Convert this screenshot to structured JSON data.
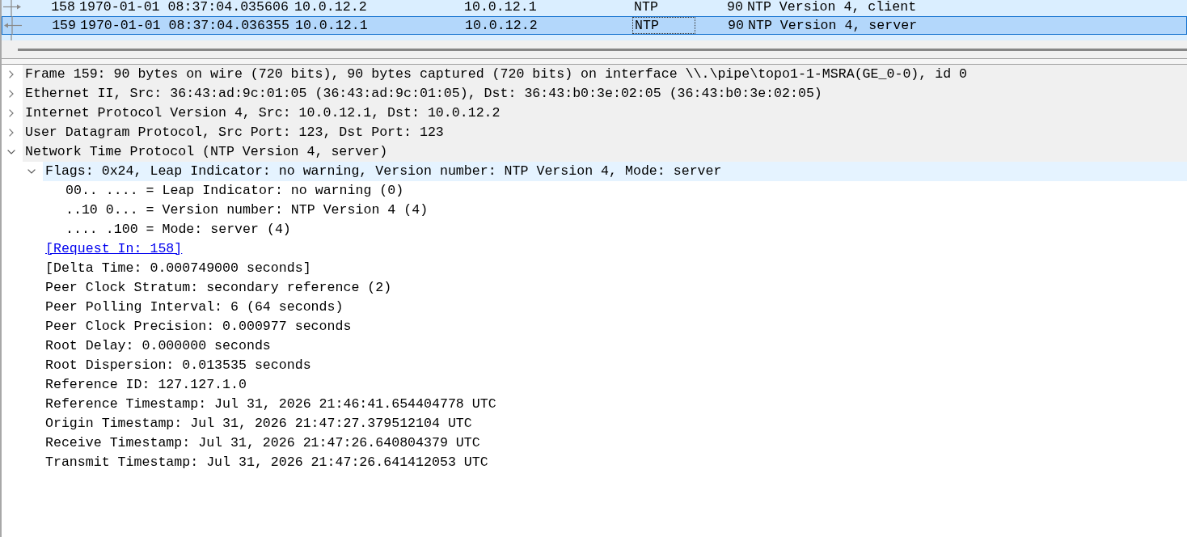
{
  "packet_list": {
    "rows": [
      {
        "no": "158",
        "time": "1970-01-01 08:37:04.035606",
        "source": "10.0.12.2",
        "destination": "10.0.12.1",
        "protocol": "NTP",
        "length": "90",
        "info": "NTP Version 4, client",
        "kind": "request",
        "selected": false,
        "focused": false
      },
      {
        "no": "159",
        "time": "1970-01-01 08:37:04.036355",
        "source": "10.0.12.1",
        "destination": "10.0.12.2",
        "protocol": "NTP",
        "length": "90",
        "info": "NTP Version 4, server",
        "kind": "response",
        "selected": true,
        "focused": true
      },
      {
        "kind": "line",
        "selected": false
      }
    ]
  },
  "details": {
    "tree": [
      {
        "label": "Frame 159: 90 bytes on wire (720 bits), 90 bytes captured (720 bits) on interface \\\\.\\pipe\\topo1-1-MSRA(GE_0-0), id 0",
        "expanded": false
      },
      {
        "label": "Ethernet II, Src: 36:43:ad:9c:01:05 (36:43:ad:9c:01:05), Dst: 36:43:b0:3e:02:05 (36:43:b0:3e:02:05)",
        "expanded": false
      },
      {
        "label": "Internet Protocol Version 4, Src: 10.0.12.1, Dst: 10.0.12.2",
        "expanded": false
      },
      {
        "label": "User Datagram Protocol, Src Port: 123, Dst Port: 123",
        "expanded": false
      },
      {
        "label": "Network Time Protocol (NTP Version 4, server)",
        "expanded": true,
        "children": [
          {
            "kind": "field",
            "label": "Flags: 0x24, Leap Indicator: no warning, Version number: NTP Version 4, Mode: server",
            "expanded": true,
            "hovered": true,
            "children": [
              {
                "label": "00.. .... = Leap Indicator: no warning (0)"
              },
              {
                "label": "..10 0... = Version number: NTP Version 4 (4)"
              },
              {
                "label": ".... .100 = Mode: server (4)"
              }
            ]
          },
          {
            "kind": "link",
            "label": "[Request In: 158]"
          },
          {
            "kind": "field",
            "label": "[Delta Time: 0.000749000 seconds]"
          },
          {
            "kind": "field",
            "label": "Peer Clock Stratum: secondary reference (2)"
          },
          {
            "kind": "field",
            "label": "Peer Polling Interval: 6 (64 seconds)"
          },
          {
            "kind": "field",
            "label": "Peer Clock Precision: 0.000977 seconds"
          },
          {
            "kind": "field",
            "label": "Root Delay: 0.000000 seconds"
          },
          {
            "kind": "field",
            "label": "Root Dispersion: 0.013535 seconds"
          },
          {
            "kind": "field",
            "label": "Reference ID: 127.127.1.0"
          },
          {
            "kind": "field",
            "label": "Reference Timestamp: Jul 31, 2026 21:46:41.654404778 UTC"
          },
          {
            "kind": "field",
            "label": "Origin Timestamp: Jul 31, 2026 21:47:27.379512104 UTC"
          },
          {
            "kind": "field",
            "label": "Receive Timestamp: Jul 31, 2026 21:47:26.640804379 UTC"
          },
          {
            "kind": "field",
            "label": "Transmit Timestamp: Jul 31, 2026 21:47:26.641412053 UTC"
          }
        ]
      }
    ]
  }
}
